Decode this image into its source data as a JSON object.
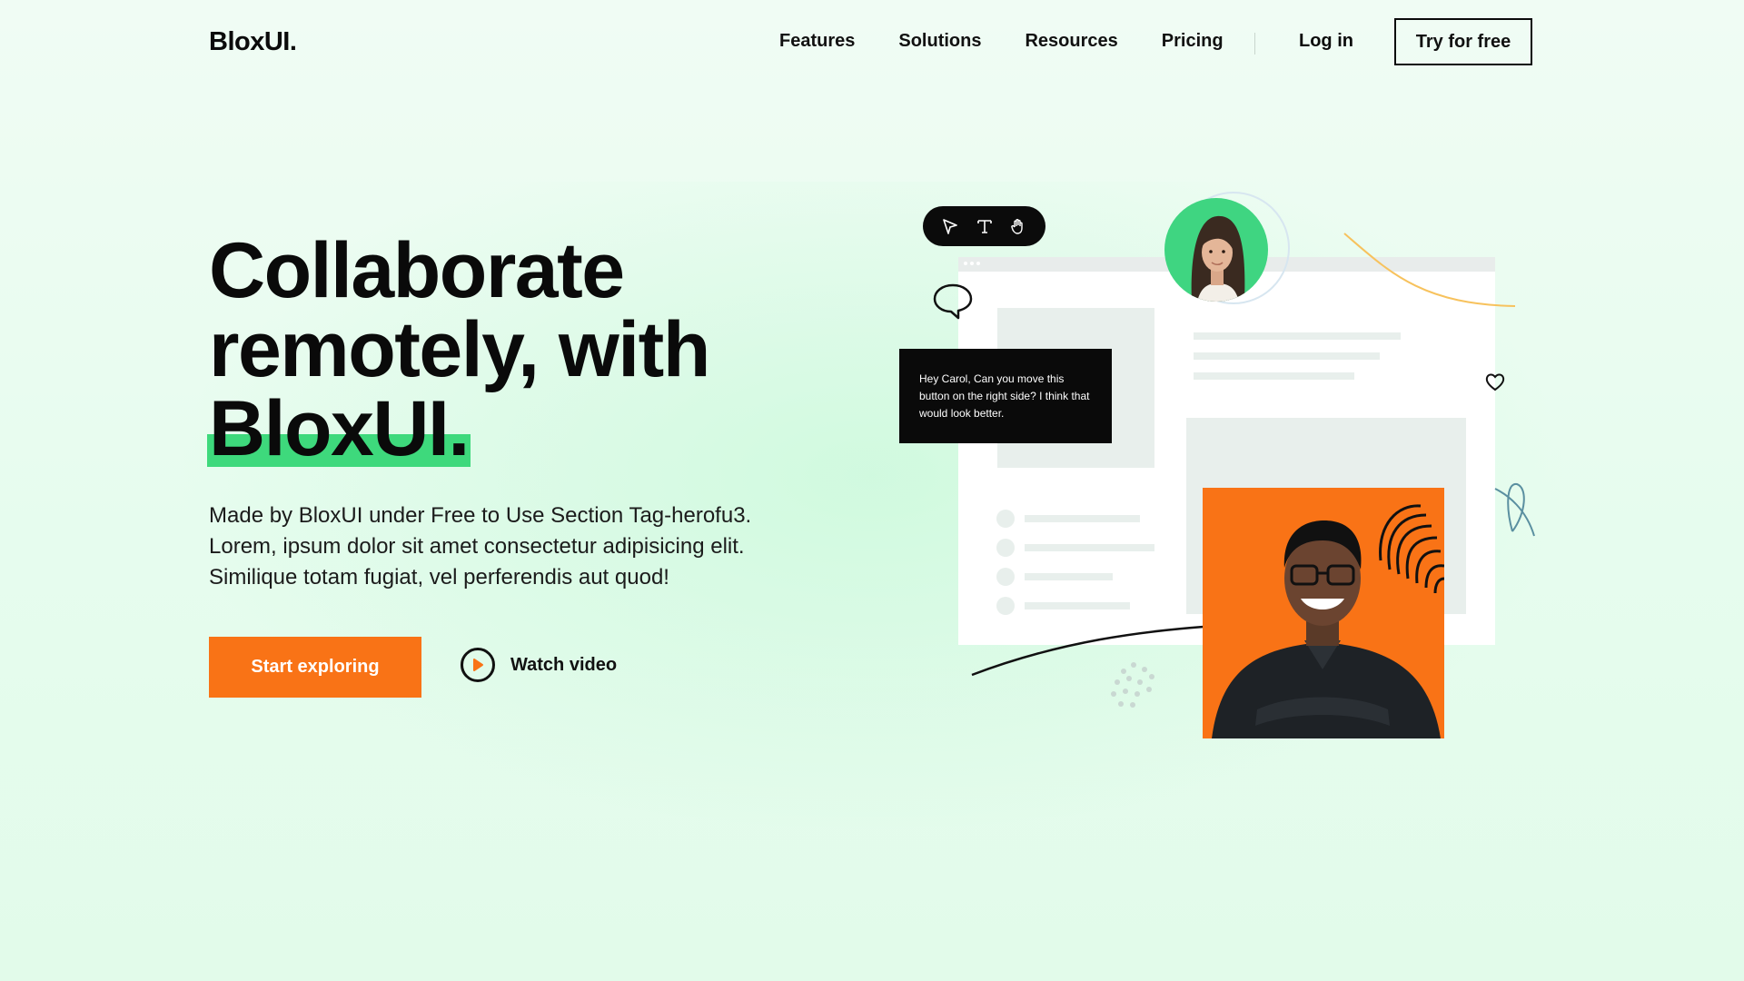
{
  "nav": {
    "logo": "BloxUI.",
    "links": [
      "Features",
      "Solutions",
      "Resources",
      "Pricing"
    ],
    "login": "Log in",
    "cta": "Try for free"
  },
  "hero": {
    "headline": [
      "Collaborate",
      "remotely, with",
      "BloxUI."
    ],
    "description": [
      "Made by BloxUI under Free to Use Section Tag-herofu3.",
      "Lorem, ipsum dolor sit amet consectetur adipisicing elit.",
      "Similique totam fugiat, vel perferendis aut quod!"
    ],
    "primary_cta": "Start exploring",
    "secondary_cta": "Watch video"
  },
  "illustration": {
    "toolbar_icons": [
      "pointer-icon",
      "text-icon",
      "hand-icon"
    ],
    "chat_message": "Hey Carol, Can you move this button on the right side? I think that would look better."
  },
  "colors": {
    "accent_orange": "#f97316",
    "accent_green": "#3ed97c",
    "background": "#e8fcef",
    "ink": "#0b0b0b"
  }
}
